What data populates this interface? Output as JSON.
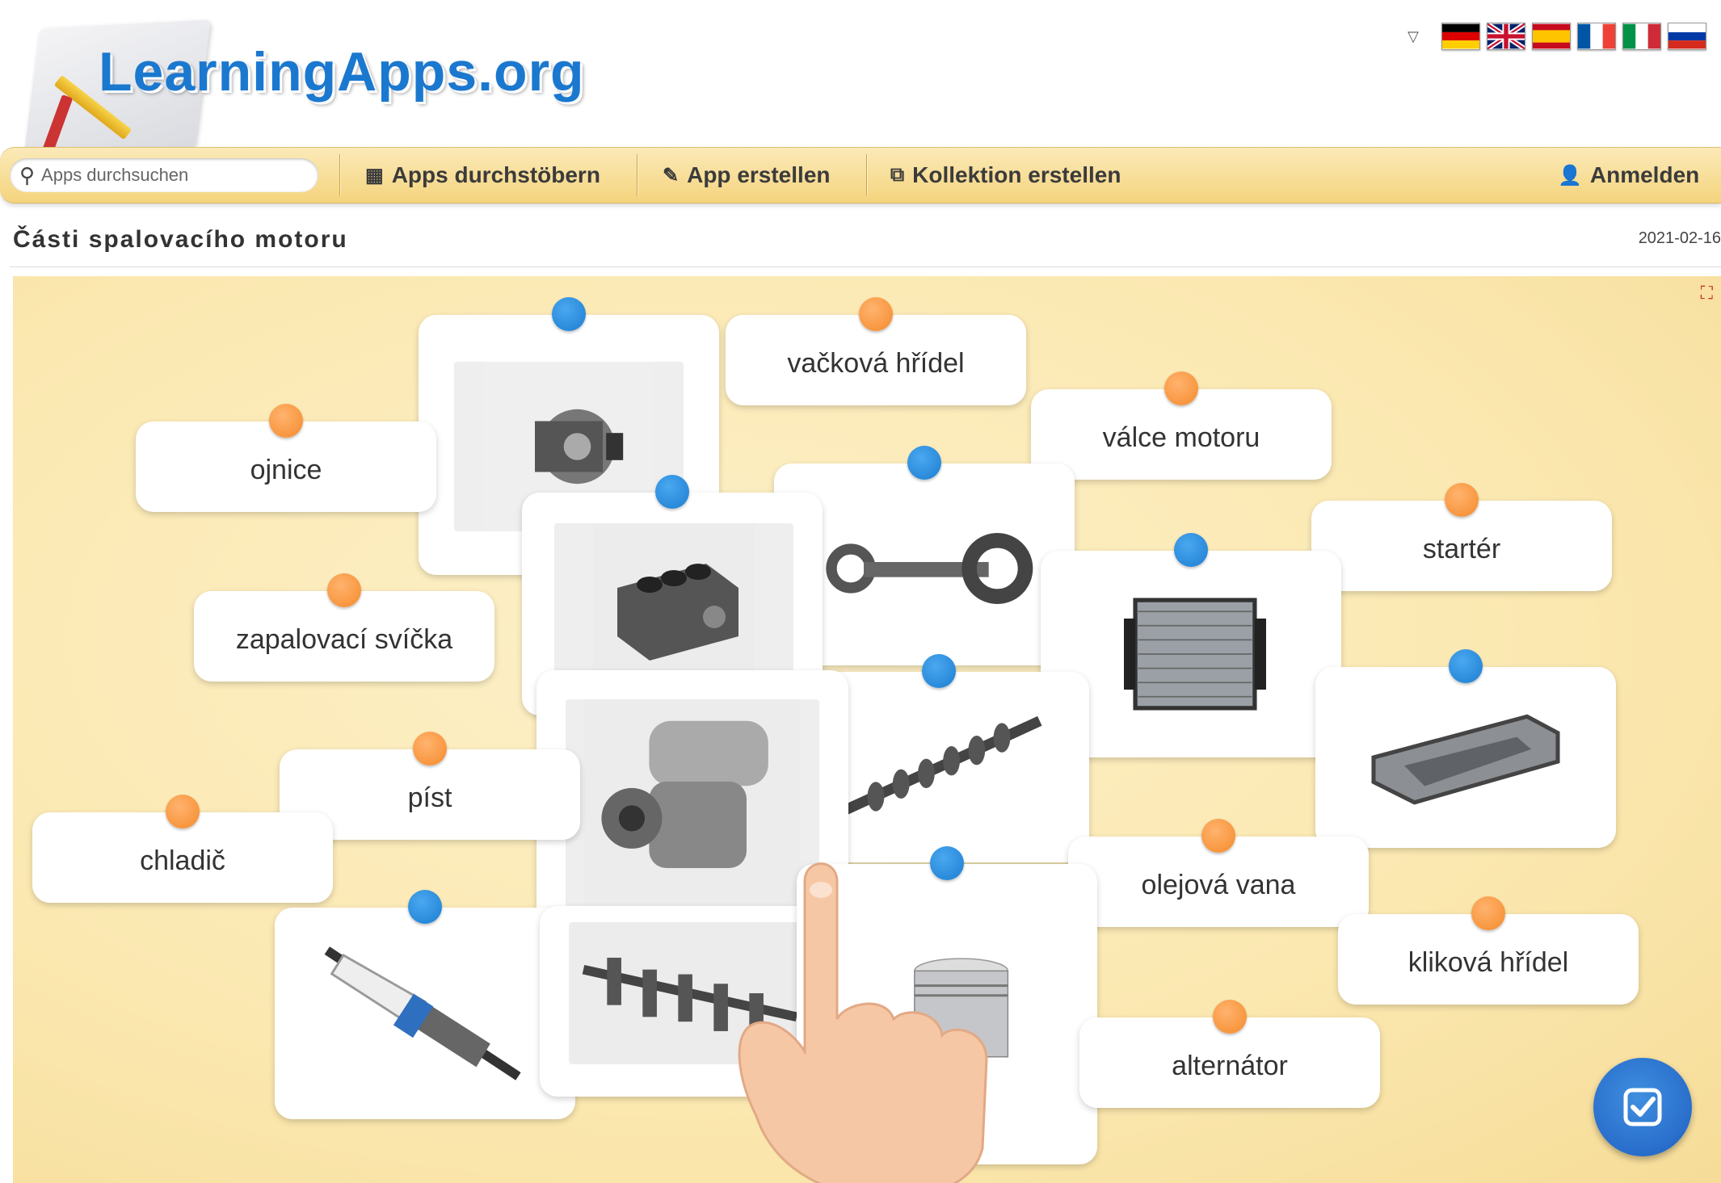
{
  "header": {
    "logo_text": "LearningApps.org",
    "languages": [
      {
        "name": "Deutsch",
        "icon": "flag-de-icon"
      },
      {
        "name": "English",
        "icon": "flag-gb-icon"
      },
      {
        "name": "Español",
        "icon": "flag-es-icon"
      },
      {
        "name": "Français",
        "icon": "flag-fr-icon"
      },
      {
        "name": "Italiano",
        "icon": "flag-it-icon"
      },
      {
        "name": "Русский",
        "icon": "flag-ru-icon"
      }
    ]
  },
  "toolbar": {
    "search_placeholder": "Apps durchsuchen",
    "browse_label": "Apps durchstöbern",
    "create_app_label": "App erstellen",
    "create_collection_label": "Kollektion erstellen",
    "login_label": "Anmelden"
  },
  "app": {
    "title": "Části spalovacího motoru",
    "date": "2021-02-16"
  },
  "cards": {
    "vackova": "vačková hřídel",
    "ojnice": "ojnice",
    "valce": "válce motoru",
    "starter": "startér",
    "svicka": "zapalovací svíčka",
    "pist": "píst",
    "chladic": "chladič",
    "olejova": "olejová vana",
    "klikova": "kliková hřídel",
    "alternator": "alternátor"
  },
  "colors": {
    "accent_blue": "#1c7dd2",
    "accent_orange": "#f58a2b",
    "board_bg": "#fbe8b0",
    "toolbar_bg": "#f4d47d"
  }
}
